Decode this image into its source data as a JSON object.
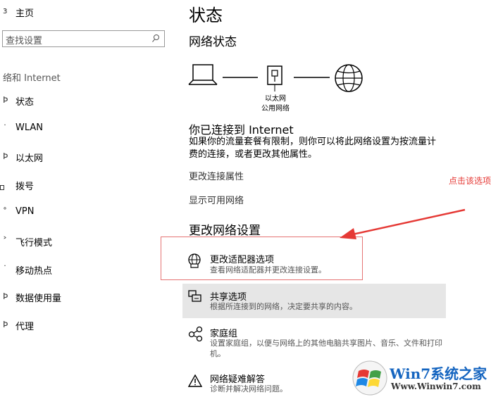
{
  "nav": {
    "home": "主页",
    "search_placeholder": "查找设置",
    "section_title": "络和 Internet",
    "items": [
      {
        "label": "状态",
        "icon": "status-icon"
      },
      {
        "label": "WLAN",
        "icon": "wifi-icon"
      },
      {
        "label": "以太网",
        "icon": "ethernet-icon"
      },
      {
        "label": "拨号",
        "icon": "dialup-icon"
      },
      {
        "label": "VPN",
        "icon": "vpn-icon"
      },
      {
        "label": "飞行模式",
        "icon": "airplane-icon"
      },
      {
        "label": "移动热点",
        "icon": "hotspot-icon"
      },
      {
        "label": "数据使用量",
        "icon": "data-usage-icon"
      },
      {
        "label": "代理",
        "icon": "proxy-icon"
      }
    ]
  },
  "main": {
    "title": "状态",
    "network_status_heading": "网络状态",
    "diagram_caption_line1": "以太网",
    "diagram_caption_line2": "公用网络",
    "connected_heading": "你已连接到 Internet",
    "connected_text_line1": "如果你的流量套餐有限制，则你可以将此网络设置为按流量计",
    "connected_text_line2": "费的连接，或者更改其他属性。",
    "change_properties_link": "更改连接属性",
    "show_networks_link": "显示可用网络",
    "change_settings_heading": "更改网络设置",
    "options": [
      {
        "title": "更改适配器选项",
        "desc_line1": "查看网络适配器并更改连接设置。",
        "desc_line2": "",
        "icon": "adapter-icon"
      },
      {
        "title": "共享选项",
        "desc_line1": "根据所连接到的网络，决定要共享的内容。",
        "desc_line2": "",
        "icon": "sharing-icon"
      },
      {
        "title": "家庭组",
        "desc_line1": "设置家庭组，以便与网络上的其他电脑共享图片、音乐、文件和打印",
        "desc_line2": "机。",
        "icon": "homegroup-icon"
      },
      {
        "title": "网络疑难解答",
        "desc_line1": "诊断并解决网络问题。",
        "desc_line2": "",
        "icon": "warning-icon"
      }
    ]
  },
  "annotation": {
    "text": "点击该选项",
    "color": "#e53935"
  },
  "watermark": {
    "brand": "Win7系统之家",
    "url": "Www.Winwin7.com"
  }
}
